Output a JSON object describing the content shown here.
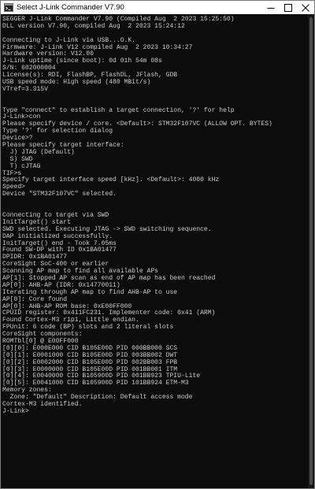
{
  "window": {
    "title": "Select J-Link Commander V7.90",
    "icon": "terminal-app-icon"
  },
  "console": {
    "lines": [
      "SEGGER J-Link Commander V7.90 (Compiled Aug  2 2023 15:25:50)",
      "DLL version V7.90, compiled Aug  2 2023 15:24:12",
      "",
      "Connecting to J-Link via USB...O.K.",
      "Firmware: J-Link V12 compiled Aug  2 2023 10:34:27",
      "Hardware version: V12.00",
      "J-Link uptime (since boot): 0d 01h 54m 08s",
      "S/N: 602000004",
      "License(s): RDI, FlashBP, FlashDL, JFlash, GDB",
      "USB speed mode: High speed (480 MBit/s)",
      "VTref=3.315V",
      "",
      "",
      "Type \"connect\" to establish a target connection, '?' for help",
      "J-Link>con",
      "Please specify device / core. <Default>: STM32F107VC (ALLOW OPT. BYTES)",
      "Type '?' for selection dialog",
      "Device>?",
      "Please specify target interface:",
      "  J) JTAG (Default)",
      "  S) SWD",
      "  T) cJTAG",
      "TIF>s",
      "Specify target interface speed [kHz]. <Default>: 4000 kHz",
      "Speed>",
      "Device \"STM32F107VC\" selected.",
      "",
      "",
      "Connecting to target via SWD",
      "InitTarget() start",
      "SWD selected. Executing JTAG -> SWD switching sequence.",
      "DAP initialized successfully.",
      "InitTarget() end - Took 7.05ms",
      "Found SW-DP with ID 0x1BA01477",
      "DPIDR: 0x1BA01477",
      "CoreSight SoC-400 or earlier",
      "Scanning AP map to find all available APs",
      "AP[1]: Stopped AP scan as end of AP map has been reached",
      "AP[0]: AHB-AP (IDR: 0x14770011)",
      "Iterating through AP map to find AHB-AP to use",
      "AP[0]: Core found",
      "AP[0]: AHB-AP ROM base: 0xE00FF000",
      "CPUID register: 0x411FC231. Implementer code: 0x41 (ARM)",
      "Found Cortex-M3 r1p1, Little endian.",
      "FPUnit: 6 code (BP) slots and 2 literal slots",
      "CoreSight components:",
      "ROMTbl[0] @ E00FF000",
      "[0][0]: E000E000 CID B105E00D PID 000BB000 SCS",
      "[0][1]: E0001000 CID B105E00D PID 003BB002 DWT",
      "[0][2]: E0002000 CID B105E00D PID 002BB003 FPB",
      "[0][3]: E0000000 CID B105E00D PID 001BB001 ITM",
      "[0][4]: E0040000 CID B105900D PID 001BB923 TPIU-Lite",
      "[0][5]: E0041000 CID B105900D PID 101BB924 ETM-M3",
      "Memory zones:",
      "  Zone: \"Default\" Description: Default access mode",
      "Cortex-M3 identified.",
      "J-Link>"
    ]
  }
}
